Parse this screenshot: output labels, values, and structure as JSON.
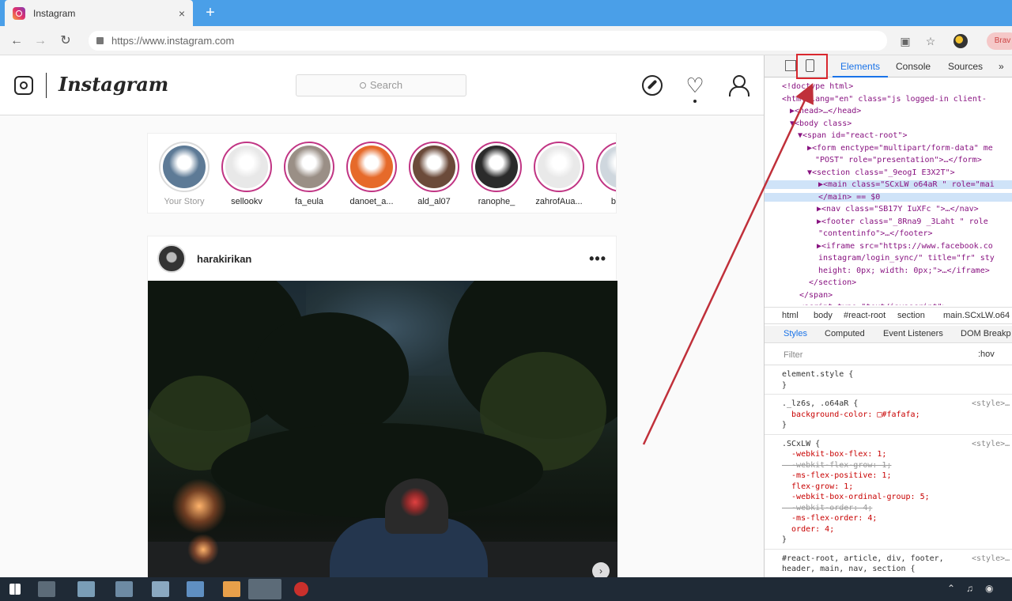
{
  "browser": {
    "tab_title": "Instagram",
    "tab_close": "×",
    "new_tab": "+",
    "url": "https://www.instagram.com",
    "ext_pill": "Brav"
  },
  "instagram": {
    "wordmark": "Instagram",
    "search_placeholder": "Search",
    "stories": [
      {
        "name": "Your Story",
        "color": "#5d7a96",
        "seen": true
      },
      {
        "name": "sellookv",
        "color": "#e8e8e8",
        "seen": false
      },
      {
        "name": "fa_eula",
        "color": "#9a8f86",
        "seen": false
      },
      {
        "name": "danoet_a...",
        "color": "#e66a2a",
        "seen": false
      },
      {
        "name": "ald_al07",
        "color": "#6b4a3a",
        "seen": false
      },
      {
        "name": "ranophe_",
        "color": "#2b2b2b",
        "seen": false
      },
      {
        "name": "zahrofАua...",
        "color": "#e9e9e9",
        "seen": false
      },
      {
        "name": "bits...",
        "color": "#cfd7de",
        "seen": false
      }
    ],
    "post": {
      "username": "harakirikan",
      "more": "•••",
      "carousel_next": "›"
    }
  },
  "devtools": {
    "tabs": [
      "Elements",
      "Console",
      "Sources"
    ],
    "active_tab": "Elements",
    "more": "»",
    "dom_lines": [
      "<!doctype html>",
      "<html lang=\"en\" class=\"js logged-in client-",
      "▶<head>…</head>",
      "▼<body class>",
      "▼<span id=\"react-root\">",
      "▶<form enctype=\"multipart/form-data\" me",
      "\"POST\" role=\"presentation\">…</form>",
      "▼<section class=\"_9eogI E3X2T\">",
      "▶<main class=\"SCxLW  o64aR \" role=\"mai",
      "</main> == $0",
      "▶<nav class=\"SB17Y IuXFc \">…</nav>",
      "▶<footer class=\"_8Rna9  _3Laht \" role",
      "\"contentinfo\">…</footer>",
      "▶<iframe src=\"https://www.facebook.co",
      "instagram/login_sync/\" title=\"fr\" sty",
      "height: 0px; width: 0px;\">…</iframe>",
      "</section>",
      "</span>",
      "<script type=\"text/javascript\">"
    ],
    "breadcrumbs": [
      "html",
      "body",
      "#react-root",
      "section",
      "main.SCxLW.o64"
    ],
    "style_tabs": [
      "Styles",
      "Computed",
      "Event Listeners",
      "DOM Breakp"
    ],
    "filter_placeholder": "Filter",
    "filter_hov": ":hov",
    "css_blocks": [
      {
        "lines": [
          "element.style {",
          "}"
        ],
        "source": ""
      },
      {
        "lines": [
          "._lz6s, .o64aR {",
          "  background-color: □#fafafa;",
          "}"
        ],
        "source": "<style>…"
      },
      {
        "lines": [
          ".SCxLW {",
          "  -webkit-box-flex: 1;",
          "  -webkit-flex-grow: 1;",
          "  -ms-flex-positive: 1;",
          "  flex-grow: 1;",
          "  -webkit-box-ordinal-group: 5;",
          "  -webkit-order: 4;",
          "  -ms-flex-order: 4;",
          "  order: 4;",
          "}"
        ],
        "source": "<style>…"
      },
      {
        "lines": [
          "#react-root, article, div, footer,",
          "header, main, nav, section {"
        ],
        "source": "<style>…"
      }
    ]
  },
  "colors": {
    "tabbar": "#4a9fe8",
    "highlight": "#d9282f",
    "arrow": "#c0303a",
    "taskbar": "#1f2a36"
  }
}
